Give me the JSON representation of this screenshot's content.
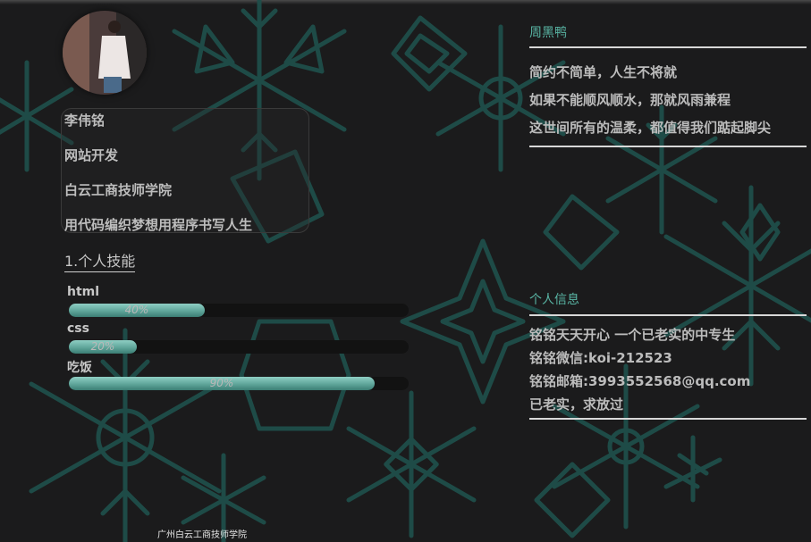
{
  "profile": {
    "name": "李伟铭",
    "role": "网站开发",
    "school": "白云工商技师学院",
    "motto": "用代码编织梦想用程序书写人生"
  },
  "skills": {
    "title": "1.个人技能",
    "items": [
      {
        "label": "html",
        "percent": 40,
        "percent_text": "40%"
      },
      {
        "label": "css",
        "percent": 20,
        "percent_text": "20%"
      },
      {
        "label": "吃饭",
        "percent": 90,
        "percent_text": "90%"
      }
    ]
  },
  "quotes": {
    "title": "周黑鸭",
    "lines": [
      "简约不简单，人生不将就",
      "如果不能顺风顺水，那就风雨兼程",
      "这世间所有的温柔，都值得我们踮起脚尖"
    ]
  },
  "info": {
    "title": "个人信息",
    "lines": [
      "铭铭天天开心 一个已老实的中专生",
      "铭铭微信:koi-212523",
      "铭铭邮箱:3993552568@qq.com",
      "已老实，求放过"
    ]
  },
  "footer": {
    "text": "广州白云工商技师学院"
  },
  "colors": {
    "accent": "#59b5a4",
    "background": "#1b1b1c",
    "pattern": "#1f4f4a",
    "bar_fill": "#7bbfb3"
  }
}
